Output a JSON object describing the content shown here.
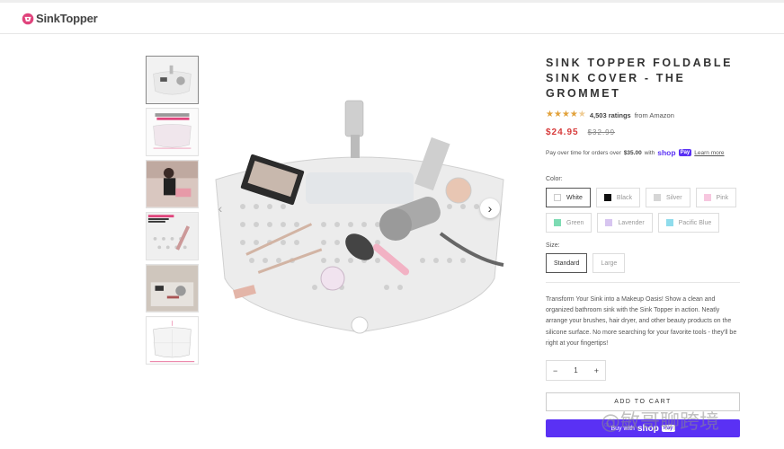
{
  "header": {
    "brand": "SinkTopper"
  },
  "gallery": {
    "thumbnails": [
      {
        "name": "thumb-sink-overview"
      },
      {
        "name": "thumb-size-diagram",
        "tags": [
          "Large Sink: 24\" Wide x 16\" Deep",
          "Small Sink: 22.75\" Wide x 14\" Deep"
        ]
      },
      {
        "name": "thumb-woman-using"
      },
      {
        "name": "thumb-textured-surface",
        "label": "TEXTURED SURFACE FOR CLEANING MAKEUP BRUSHES"
      },
      {
        "name": "thumb-lifestyle"
      },
      {
        "name": "thumb-dimensions"
      }
    ]
  },
  "product": {
    "title": "SINK TOPPER FOLDABLE SINK COVER - THE GROMMET",
    "rating_value": 4.5,
    "rating_count": "4,503 ratings",
    "rating_source": "from Amazon",
    "price": "$24.95",
    "compare_price": "$32.99",
    "installments_text": "Pay over time for orders over",
    "installments_threshold": "$35.00",
    "installments_with": "with",
    "shop_word": "shop",
    "pay_word": "Pay",
    "learn_more": "Learn more",
    "color_label": "Color:",
    "colors": [
      {
        "name": "White",
        "hex": "#ffffff",
        "selected": true
      },
      {
        "name": "Black",
        "hex": "#111111",
        "selected": false
      },
      {
        "name": "Silver",
        "hex": "#d6d6d6",
        "selected": false
      },
      {
        "name": "Pink",
        "hex": "#f7c7df",
        "selected": false
      },
      {
        "name": "Green",
        "hex": "#7ddbb3",
        "selected": false
      },
      {
        "name": "Lavender",
        "hex": "#d7c5f0",
        "selected": false
      },
      {
        "name": "Pacific Blue",
        "hex": "#8fdcec",
        "selected": false
      }
    ],
    "size_label": "Size:",
    "sizes": [
      {
        "name": "Standard",
        "selected": true
      },
      {
        "name": "Large",
        "selected": false
      }
    ],
    "description": "Transform Your Sink into a Makeup Oasis! Show a clean and organized bathroom sink with the Sink Topper in action. Neatly arrange your brushes, hair dryer, and other beauty products on the silicone surface. No more searching for your favorite tools - they'll be right at your fingertips!",
    "quantity": "1",
    "minus": "−",
    "plus": "+",
    "add_to_cart": "ADD TO CART",
    "buy_with": "Buy with"
  },
  "watermark": {
    "text": "@敏哥聊跨境",
    "small": "du"
  },
  "colors": {
    "accent": "#5a31f4",
    "price_red": "#d73a3a",
    "star": "#e2a23b",
    "brand_pink": "#e0447c"
  }
}
